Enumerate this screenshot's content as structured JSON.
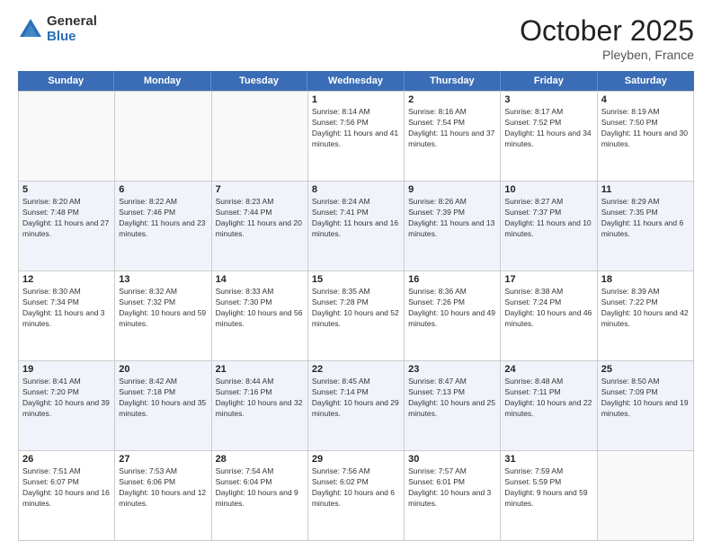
{
  "header": {
    "logo_general": "General",
    "logo_blue": "Blue",
    "month": "October 2025",
    "location": "Pleyben, France"
  },
  "days_of_week": [
    "Sunday",
    "Monday",
    "Tuesday",
    "Wednesday",
    "Thursday",
    "Friday",
    "Saturday"
  ],
  "weeks": [
    [
      {
        "day": "",
        "info": ""
      },
      {
        "day": "",
        "info": ""
      },
      {
        "day": "",
        "info": ""
      },
      {
        "day": "1",
        "info": "Sunrise: 8:14 AM\nSunset: 7:56 PM\nDaylight: 11 hours and 41 minutes."
      },
      {
        "day": "2",
        "info": "Sunrise: 8:16 AM\nSunset: 7:54 PM\nDaylight: 11 hours and 37 minutes."
      },
      {
        "day": "3",
        "info": "Sunrise: 8:17 AM\nSunset: 7:52 PM\nDaylight: 11 hours and 34 minutes."
      },
      {
        "day": "4",
        "info": "Sunrise: 8:19 AM\nSunset: 7:50 PM\nDaylight: 11 hours and 30 minutes."
      }
    ],
    [
      {
        "day": "5",
        "info": "Sunrise: 8:20 AM\nSunset: 7:48 PM\nDaylight: 11 hours and 27 minutes."
      },
      {
        "day": "6",
        "info": "Sunrise: 8:22 AM\nSunset: 7:46 PM\nDaylight: 11 hours and 23 minutes."
      },
      {
        "day": "7",
        "info": "Sunrise: 8:23 AM\nSunset: 7:44 PM\nDaylight: 11 hours and 20 minutes."
      },
      {
        "day": "8",
        "info": "Sunrise: 8:24 AM\nSunset: 7:41 PM\nDaylight: 11 hours and 16 minutes."
      },
      {
        "day": "9",
        "info": "Sunrise: 8:26 AM\nSunset: 7:39 PM\nDaylight: 11 hours and 13 minutes."
      },
      {
        "day": "10",
        "info": "Sunrise: 8:27 AM\nSunset: 7:37 PM\nDaylight: 11 hours and 10 minutes."
      },
      {
        "day": "11",
        "info": "Sunrise: 8:29 AM\nSunset: 7:35 PM\nDaylight: 11 hours and 6 minutes."
      }
    ],
    [
      {
        "day": "12",
        "info": "Sunrise: 8:30 AM\nSunset: 7:34 PM\nDaylight: 11 hours and 3 minutes."
      },
      {
        "day": "13",
        "info": "Sunrise: 8:32 AM\nSunset: 7:32 PM\nDaylight: 10 hours and 59 minutes."
      },
      {
        "day": "14",
        "info": "Sunrise: 8:33 AM\nSunset: 7:30 PM\nDaylight: 10 hours and 56 minutes."
      },
      {
        "day": "15",
        "info": "Sunrise: 8:35 AM\nSunset: 7:28 PM\nDaylight: 10 hours and 52 minutes."
      },
      {
        "day": "16",
        "info": "Sunrise: 8:36 AM\nSunset: 7:26 PM\nDaylight: 10 hours and 49 minutes."
      },
      {
        "day": "17",
        "info": "Sunrise: 8:38 AM\nSunset: 7:24 PM\nDaylight: 10 hours and 46 minutes."
      },
      {
        "day": "18",
        "info": "Sunrise: 8:39 AM\nSunset: 7:22 PM\nDaylight: 10 hours and 42 minutes."
      }
    ],
    [
      {
        "day": "19",
        "info": "Sunrise: 8:41 AM\nSunset: 7:20 PM\nDaylight: 10 hours and 39 minutes."
      },
      {
        "day": "20",
        "info": "Sunrise: 8:42 AM\nSunset: 7:18 PM\nDaylight: 10 hours and 35 minutes."
      },
      {
        "day": "21",
        "info": "Sunrise: 8:44 AM\nSunset: 7:16 PM\nDaylight: 10 hours and 32 minutes."
      },
      {
        "day": "22",
        "info": "Sunrise: 8:45 AM\nSunset: 7:14 PM\nDaylight: 10 hours and 29 minutes."
      },
      {
        "day": "23",
        "info": "Sunrise: 8:47 AM\nSunset: 7:13 PM\nDaylight: 10 hours and 25 minutes."
      },
      {
        "day": "24",
        "info": "Sunrise: 8:48 AM\nSunset: 7:11 PM\nDaylight: 10 hours and 22 minutes."
      },
      {
        "day": "25",
        "info": "Sunrise: 8:50 AM\nSunset: 7:09 PM\nDaylight: 10 hours and 19 minutes."
      }
    ],
    [
      {
        "day": "26",
        "info": "Sunrise: 7:51 AM\nSunset: 6:07 PM\nDaylight: 10 hours and 16 minutes."
      },
      {
        "day": "27",
        "info": "Sunrise: 7:53 AM\nSunset: 6:06 PM\nDaylight: 10 hours and 12 minutes."
      },
      {
        "day": "28",
        "info": "Sunrise: 7:54 AM\nSunset: 6:04 PM\nDaylight: 10 hours and 9 minutes."
      },
      {
        "day": "29",
        "info": "Sunrise: 7:56 AM\nSunset: 6:02 PM\nDaylight: 10 hours and 6 minutes."
      },
      {
        "day": "30",
        "info": "Sunrise: 7:57 AM\nSunset: 6:01 PM\nDaylight: 10 hours and 3 minutes."
      },
      {
        "day": "31",
        "info": "Sunrise: 7:59 AM\nSunset: 5:59 PM\nDaylight: 9 hours and 59 minutes."
      },
      {
        "day": "",
        "info": ""
      }
    ]
  ],
  "row_shaded": [
    1,
    3
  ]
}
